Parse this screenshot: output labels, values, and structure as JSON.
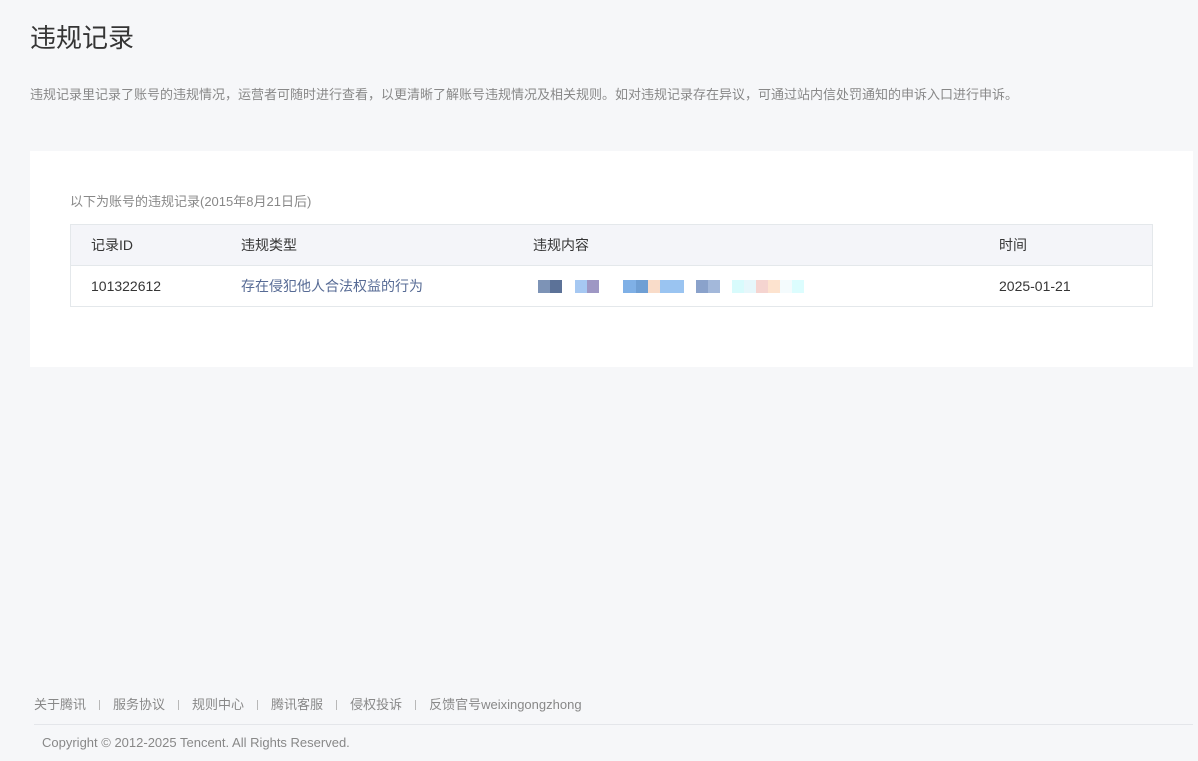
{
  "header": {
    "title": "违规记录",
    "description": "违规记录里记录了账号的违规情况，运营者可随时进行查看，以更清晰了解账号违规情况及相关规则。如对违规记录存在异议，可通过站内信处罚通知的申诉入口进行申诉。"
  },
  "records": {
    "caption": "以下为账号的违规记录(2015年8月21日后)",
    "columns": {
      "id": "记录ID",
      "type": "违规类型",
      "content": "违规内容",
      "time": "时间"
    },
    "rows": [
      {
        "id": "101322612",
        "type": "存在侵犯他人合法权益的行为",
        "time": "2025-01-21"
      }
    ]
  },
  "footer": {
    "links": [
      "关于腾讯",
      "服务协议",
      "规则中心",
      "腾讯客服",
      "侵权投诉",
      "反馈官号weixingongzhong"
    ],
    "copyright": "Copyright © 2012-2025 Tencent. All Rights Reserved."
  },
  "colors": {
    "background": "#f6f7f9",
    "card": "#ffffff",
    "table_header": "#f4f5f9",
    "link": "#576b95",
    "muted_text": "#888888"
  }
}
